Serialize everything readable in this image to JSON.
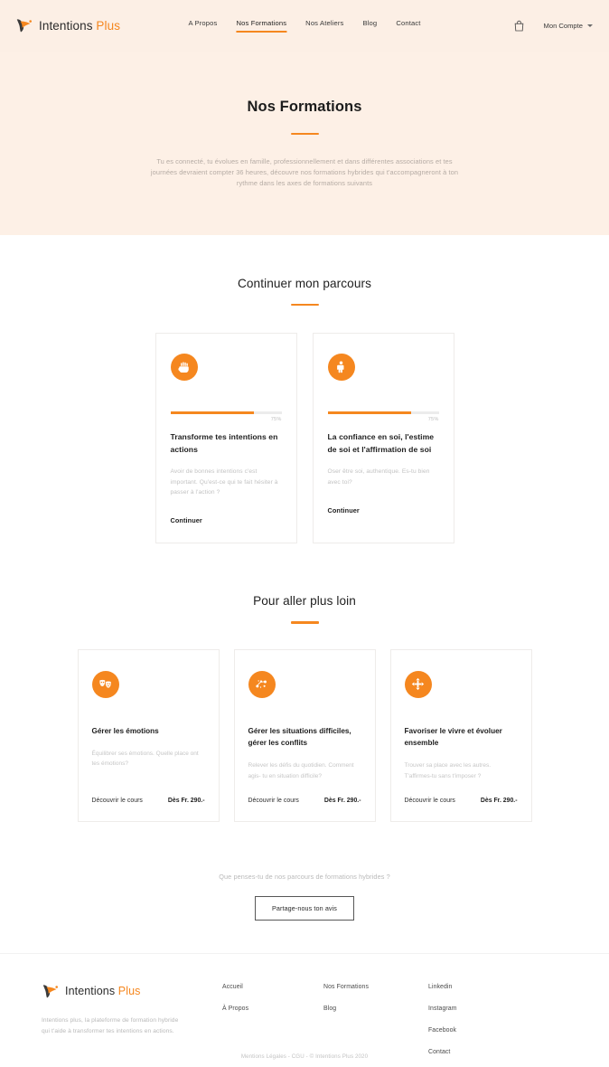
{
  "brand": {
    "name": "Intentions",
    "accent": "Plus",
    "accent_color": "#F5871F"
  },
  "header": {
    "nav": [
      {
        "label": "A Propos",
        "active": false
      },
      {
        "label": "Nos Formations",
        "active": true
      },
      {
        "label": "Nos Ateliers",
        "active": false
      },
      {
        "label": "Blog",
        "active": false
      },
      {
        "label": "Contact",
        "active": false
      }
    ],
    "cart_icon": "shopping-bag-icon",
    "account_label": "Mon Compte",
    "account_caret": "chevron-down-icon"
  },
  "hero": {
    "title": "Nos Formations",
    "subtitle": "Tu es connecté, tu évolues en famille, professionnellement et dans différentes associations et tes journées devraient compter 36 heures, découvre nos formations hybrides qui t'accompagneront à ton rythme dans les axes de formations suivants",
    "background": "#FDF0E6"
  },
  "progress_section": {
    "title": "Continuer mon parcours",
    "cards": [
      {
        "icon": "raised-fist-icon",
        "progress": 75,
        "progress_label": "75%",
        "title": "Transforme tes intentions en actions",
        "description": "Avoir de bonnes intentions c'est important. Qu'est-ce qui te fait hésiter à passer à l'action ?",
        "cta": "Continuer"
      },
      {
        "icon": "standing-person-icon",
        "progress": 75,
        "progress_label": "75%",
        "title": "La confiance en soi, l'estime de soi et l'affirmation de soi",
        "description": "Oser être soi, authentique. Es-tu bien avec toi?",
        "cta": "Continuer"
      }
    ]
  },
  "discover_section": {
    "title": "Pour aller plus loin",
    "cards": [
      {
        "icon": "theater-masks-icon",
        "title": "Gérer les émotions",
        "description": "Équilibrer ses émotions. Quelle place ont tes émotions?",
        "link": "Découvrir le cours",
        "price": "Dès Fr. 290.-"
      },
      {
        "icon": "network-nodes-icon",
        "title": "Gérer les situations difficiles, gérer les conflits",
        "description": "Relever les défis du quotidien. Comment agis- tu en situation difficile?",
        "link": "Découvrir le cours",
        "price": "Dès Fr. 290.-"
      },
      {
        "icon": "expand-arrows-icon",
        "title": "Favoriser le vivre et évoluer ensemble",
        "description": "Trouver sa place avec les autres. T'affirmes-tu sans t'imposer ?",
        "link": "Découvrir le cours",
        "price": "Dès Fr. 290.-"
      }
    ]
  },
  "feedback": {
    "question": "Que penses-tu de nos parcours de formations hybrides ?",
    "button": "Partage-nous ton avis"
  },
  "footer": {
    "blurb": "Intentions plus, la plateforme de formation hybride qui t'aide à transformer tes intentions en actions.",
    "col1": [
      "Accueil",
      "À Propos"
    ],
    "col2": [
      "Nos Formations",
      "Blog"
    ],
    "col3": [
      "Linkedin",
      "Instagram",
      "Facebook",
      "Contact"
    ],
    "copyright": "Mentions Légales - CGU - © Intentions Plus 2020"
  }
}
